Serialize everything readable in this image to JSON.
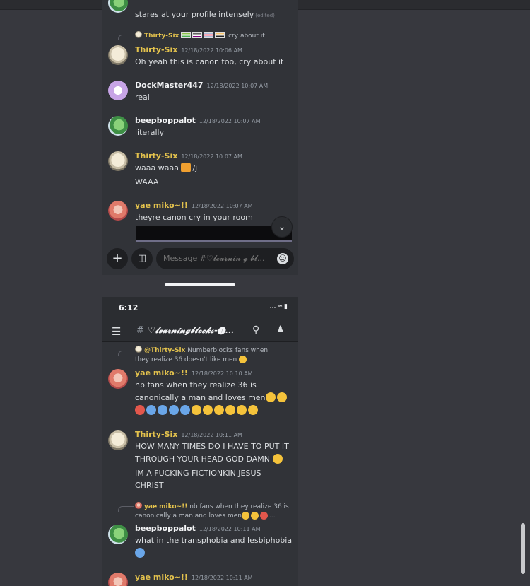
{
  "colors": {
    "background": "#37383e",
    "chat_bg": "#313338",
    "name_yellow": "#e3c24d",
    "timestamp": "#949ba4"
  },
  "top_screen": {
    "partial_message": {
      "text": "stares at your profile intensely",
      "edited": "(edited)"
    },
    "reply1": {
      "author": "Thirty-Six",
      "text": "cry about it"
    },
    "messages": [
      {
        "author": "Thirty-Six",
        "time": "12/18/2022 10:06 AM",
        "lines": [
          "Oh yeah this is canon too, cry about it"
        ]
      },
      {
        "author": "DockMaster447",
        "time": "12/18/2022 10:07 AM",
        "lines": [
          "real"
        ]
      },
      {
        "author": "beepboppalot",
        "time": "12/18/2022 10:07 AM",
        "lines": [
          "literally"
        ]
      },
      {
        "author": "Thirty-Six",
        "time": "12/18/2022 10:07 AM",
        "lines": [
          "waaa waaa",
          "/j",
          "WAAA"
        ]
      },
      {
        "author": "yae miko~!!",
        "time": "12/18/2022 10:07 AM",
        "lines": [
          "theyre canon cry in your room"
        ]
      }
    ],
    "composer": {
      "placeholder": "Message #♡𝓵𝓮𝓪𝓻𝓷𝓲𝓷 𝓰 𝓫𝓵..."
    }
  },
  "bottom_screen": {
    "clock": "6:12",
    "channel_hash": "#",
    "channel_name": "♡𝓵𝓮𝓪𝓻𝓷𝓲𝓷𝓰𝓫𝓵𝓸𝓬𝓴𝓼-❶...",
    "reply1": {
      "author": "@Thirty-Six",
      "text": "Numberblocks fans when",
      "text2": "they realize 36 doesn't like men"
    },
    "messages": [
      {
        "author": "yae miko~!!",
        "time": "12/18/2022 10:10 AM",
        "line1": "nb fans when they realize 36 is",
        "line2": "canonically a man and loves men"
      },
      {
        "author": "Thirty-Six",
        "time": "12/18/2022 10:11 AM",
        "line1": "HOW MANY TIMES DO I HAVE TO PUT IT",
        "line2": "THROUGH YOUR HEAD GOD DAMN",
        "line3": "IM A FUCKING FICTIONKIN JESUS",
        "line4": "CHRIST"
      },
      {
        "author": "beepboppalot",
        "time": "12/18/2022 10:11 AM",
        "line1": "what in the transphobia and lesbiphobia"
      },
      {
        "author": "yae miko~!!",
        "time": "12/18/2022 10:11 AM"
      }
    ],
    "reply2": {
      "author": "yae miko~!!",
      "text": "nb fans when they realize 36 is",
      "text2": "canonically a man and loves men"
    }
  }
}
